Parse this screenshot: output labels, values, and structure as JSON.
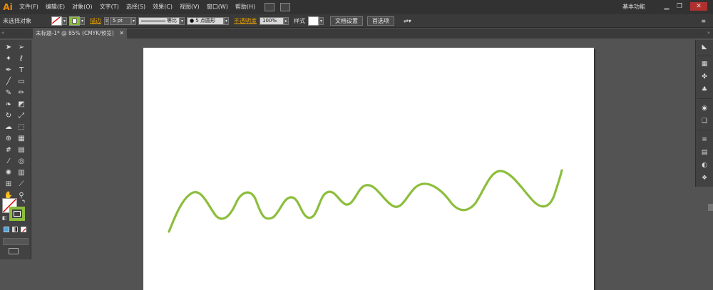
{
  "app": {
    "logo": "Ai",
    "workspace": "基本功能"
  },
  "menu": [
    "文件(F)",
    "编辑(E)",
    "对象(O)",
    "文字(T)",
    "选择(S)",
    "效果(C)",
    "视图(V)",
    "窗口(W)",
    "帮助(H)"
  ],
  "window_controls": {
    "minimize": "▁",
    "restore": "❐",
    "close": "✕"
  },
  "controlbar": {
    "selection": "未选择对象",
    "stroke_label": "描边",
    "stroke_weight": "5 pt",
    "profile": "等比",
    "brush": "5 点圆形",
    "opacity_label": "不透明度",
    "opacity": "100%",
    "style_label": "样式",
    "doc_setup": "文档设置",
    "preferences": "首选项"
  },
  "document": {
    "tab_title": "未标题-1* @ 85% (CMYK/预览)",
    "close": "✕"
  },
  "colors": {
    "stroke": "#8cbe3c",
    "canvas": "#535353",
    "artboard": "#ffffff"
  },
  "tools": [
    "selection-icon",
    "direct-selection-icon",
    "magic-wand-icon",
    "lasso-icon",
    "pen-icon",
    "type-icon",
    "line-icon",
    "rectangle-icon",
    "paintbrush-icon",
    "pencil-icon",
    "blob-brush-icon",
    "eraser-icon",
    "rotate-icon",
    "scale-icon",
    "warp-icon",
    "free-transform-icon",
    "shape-builder-icon",
    "perspective-icon",
    "mesh-icon",
    "gradient-icon",
    "eyedropper-icon",
    "blend-icon",
    "symbol-sprayer-icon",
    "column-graph-icon",
    "artboard-icon",
    "slice-icon",
    "hand-icon",
    "zoom-icon"
  ],
  "panel_icons": [
    "color-panel-icon",
    "swatches-panel-icon",
    "brushes-panel-icon",
    "symbols-panel-icon",
    "appearance-panel-icon",
    "graphic-styles-panel-icon",
    "stroke-panel-icon",
    "gradient-panel-icon",
    "transparency-panel-icon",
    "layers-panel-icon"
  ]
}
